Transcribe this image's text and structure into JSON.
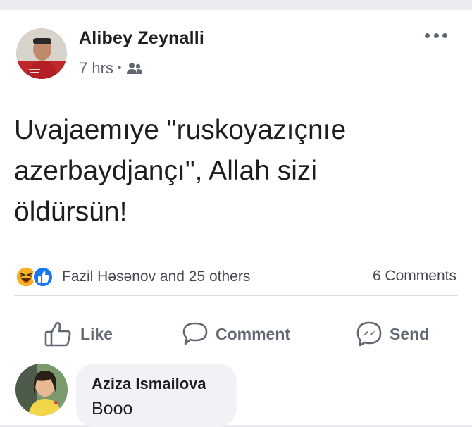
{
  "post": {
    "author": "Alibey Zeynalli",
    "time": "7 hrs",
    "separator": "•",
    "audience_icon": "friends-icon",
    "text": "Uvajaemıye \"ruskoyazıçnıe\nazerbaydjançı\", Allah sizi\nöldürsün!"
  },
  "reactions": {
    "icons": [
      "haha-icon",
      "like-icon"
    ],
    "summary": "Fazil Həsənov and 25 others",
    "comments_count": "6 Comments"
  },
  "actions": {
    "like": "Like",
    "comment": "Comment",
    "send": "Send"
  },
  "comment": {
    "author": "Aziza Ismailova",
    "text": "Booo"
  },
  "colors": {
    "like_blue": "#1877f2",
    "haha_yellow": "#f7b125",
    "muted_text": "#606770",
    "bubble_bg": "#f0f2f5"
  }
}
